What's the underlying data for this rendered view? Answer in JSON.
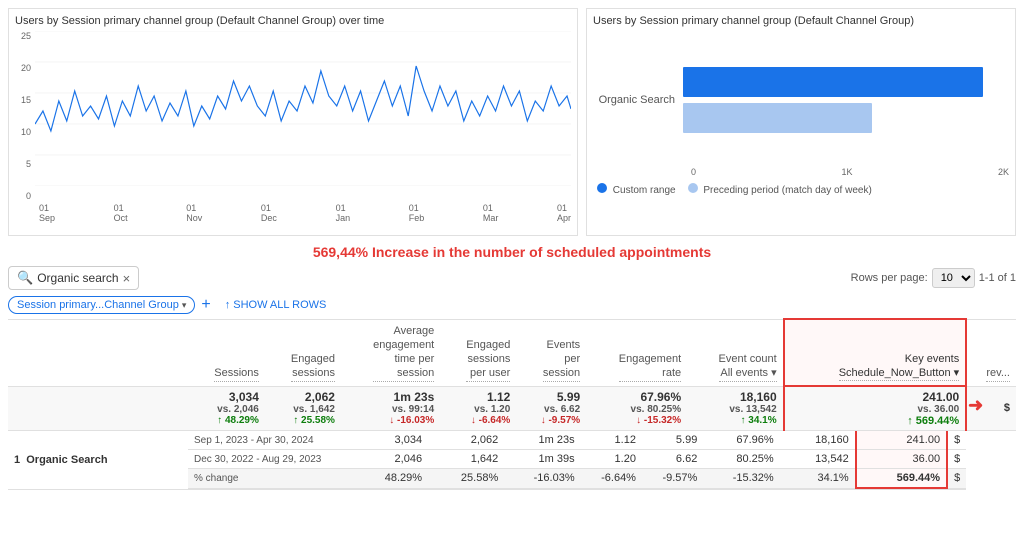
{
  "lineChart": {
    "title": "Users by Session primary channel group (Default Channel Group) over time",
    "yLabels": [
      "25",
      "20",
      "15",
      "10",
      "5",
      "0"
    ],
    "xLabels": [
      "01\nSep",
      "01\nOct",
      "01\nNov",
      "01\nDec",
      "01\nJan",
      "01\nFeb",
      "01\nMar",
      "01\nApr"
    ]
  },
  "barChart": {
    "title": "Users by Session primary channel group (Default Channel Group)",
    "label": "Organic Search",
    "primaryWidth": 92,
    "secondaryWidth": 58,
    "xLabels": [
      "0",
      "1K",
      "2K"
    ],
    "legend": {
      "custom": "Custom range",
      "preceding": "Preceding period (match day of week)"
    }
  },
  "annotation": "569,44% Increase in the number of scheduled appointments",
  "search": {
    "placeholder": "Organic search",
    "clear_label": "×"
  },
  "rowsPerPage": {
    "label": "Rows per page:",
    "value": "10",
    "pagination": "1-1 of 1"
  },
  "filter": {
    "chip_label": "Session primary...Channel Group",
    "add_label": "+",
    "show_all": "↑ SHOW ALL ROWS"
  },
  "table": {
    "columns": [
      {
        "key": "dimension",
        "label": ""
      },
      {
        "key": "sessions",
        "label": "Sessions"
      },
      {
        "key": "engaged_sessions",
        "label": "Engaged\nsessions"
      },
      {
        "key": "avg_engagement_time",
        "label": "Average\nengagement\ntime per\nsession"
      },
      {
        "key": "engaged_per_user",
        "label": "Engaged\nsessions\nper user"
      },
      {
        "key": "events_per_session",
        "label": "Events\nper\nsession"
      },
      {
        "key": "engagement_rate",
        "label": "Engagement\nrate"
      },
      {
        "key": "event_count",
        "label": "Event count\nAll events"
      },
      {
        "key": "key_events",
        "label": "Key events\nSchedule_Now_Button"
      },
      {
        "key": "revenue",
        "label": "rev..."
      }
    ],
    "summary": {
      "dimension": "",
      "sessions": "3,034",
      "sessions_vs": "vs. 2,046",
      "sessions_change": "↑ 48.29%",
      "sessions_change_type": "positive",
      "engaged_sessions": "2,062",
      "engaged_sessions_vs": "vs. 1,642",
      "engaged_sessions_change": "↑ 25.58%",
      "engaged_sessions_change_type": "positive",
      "avg_engagement_time": "1m 23s",
      "avg_engagement_time_vs": "vs. 99:14",
      "avg_engagement_time_change": "↓ -16.03%",
      "avg_engagement_time_change_type": "negative",
      "engaged_per_user": "1.12",
      "engaged_per_user_vs": "vs. 1.20",
      "engaged_per_user_change": "↓ -6.64%",
      "engaged_per_user_change_type": "negative",
      "events_per_session": "5.99",
      "events_per_session_vs": "vs. 6.62",
      "events_per_session_change": "↓ -9.57%",
      "events_per_session_change_type": "negative",
      "engagement_rate": "67.96%",
      "engagement_rate_vs": "vs. 80.25%",
      "engagement_rate_change": "↓ -15.32%",
      "engagement_rate_change_type": "negative",
      "event_count": "18,160",
      "event_count_vs": "vs. 13,542",
      "event_count_change": "↑ 34.1%",
      "event_count_change_type": "positive",
      "key_events": "241.00",
      "key_events_vs": "vs. 36.00",
      "key_events_change": "↑ 569.44%",
      "key_events_change_type": "highlight"
    },
    "rows": [
      {
        "num": "1",
        "dimension": "Organic Search",
        "row1_label": "Sep 1, 2023 - Apr 30, 2024",
        "row2_label": "Dec 30, 2022 - Aug 29, 2023",
        "row3_label": "% change",
        "sessions_r1": "3,034",
        "sessions_r2": "2,046",
        "sessions_r3": "48.29%",
        "engaged_r1": "2,062",
        "engaged_r2": "1,642",
        "engaged_r3": "25.58%",
        "avg_r1": "1m 23s",
        "avg_r2": "1m 39s",
        "avg_r3": "-16.03%",
        "eng_per_user_r1": "1.12",
        "eng_per_user_r2": "1.20",
        "eng_per_user_r3": "-6.64%",
        "events_r1": "5.99",
        "events_r2": "6.62",
        "events_r3": "-9.57%",
        "eng_rate_r1": "67.96%",
        "eng_rate_r2": "80.25%",
        "eng_rate_r3": "-15.32%",
        "event_count_r1": "18,160",
        "event_count_r2": "13,542",
        "event_count_r3": "34.1%",
        "key_events_r1": "241.00",
        "key_events_r2": "36.00",
        "key_events_r3": "569.44%"
      }
    ]
  }
}
